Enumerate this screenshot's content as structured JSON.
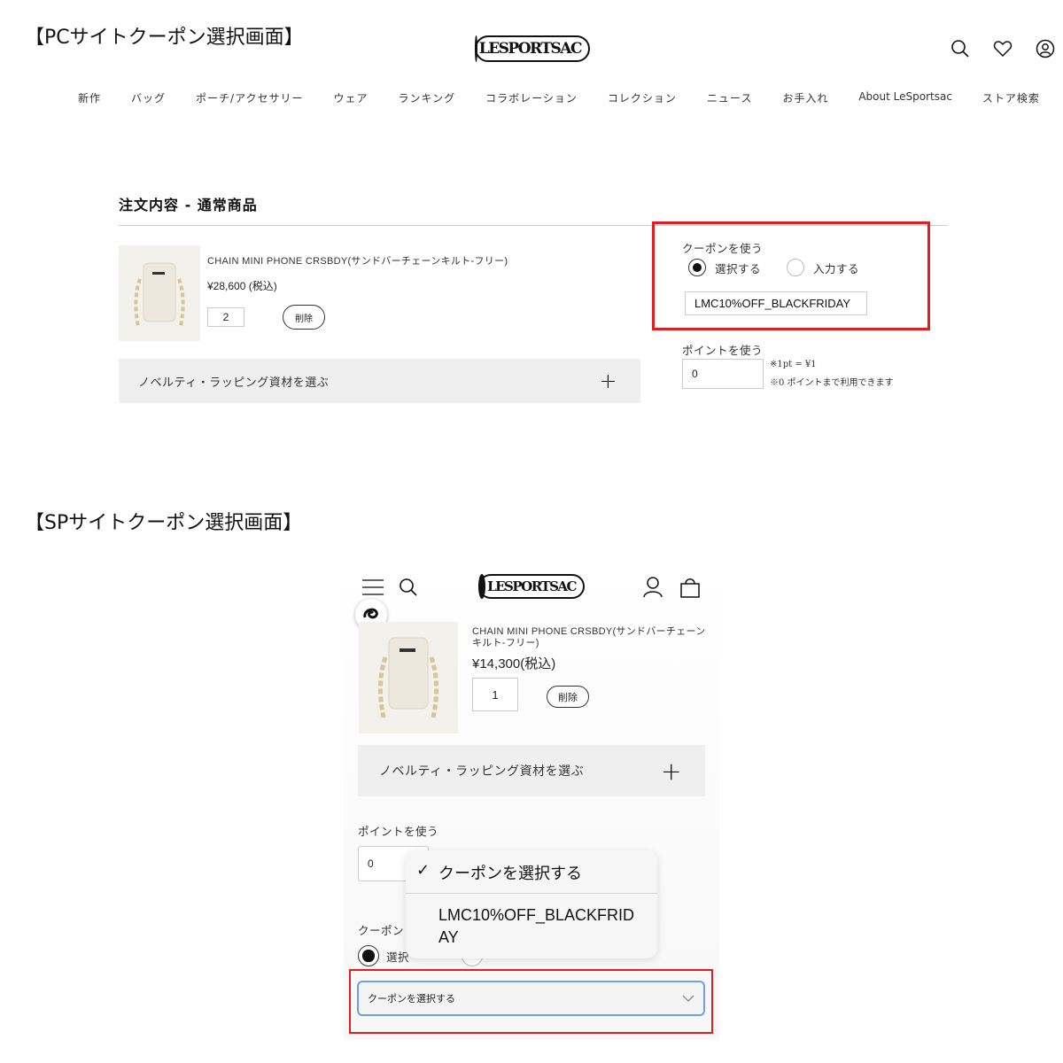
{
  "pc": {
    "section_title": "【PCサイトクーポン選択画面】",
    "logo_text": "LESPORTSAC",
    "nav": [
      "新作",
      "バッグ",
      "ポーチ/アクセサリー",
      "ウェア",
      "ランキング",
      "コラボレーション",
      "コレクション",
      "ニュース",
      "お手入れ",
      "About LeSportsac",
      "ストア検索"
    ],
    "icons": [
      "search-icon",
      "heart-icon",
      "account-icon"
    ],
    "order_title": "注文内容 - 通常商品",
    "product": {
      "name": "CHAIN MINI PHONE CRSBDY(サンドバーチェーンキルト-フリー)",
      "price": "¥28,600 (税込)",
      "quantity": "2",
      "delete_label": "削除"
    },
    "novelty_label": "ノベルティ・ラッピング資材を選ぶ",
    "novelty_toggle": "+",
    "coupon": {
      "label": "クーポンを使う",
      "option_select": "選択する",
      "option_input": "入力する",
      "selected_option": "選択する",
      "selected_value": "LMC10%OFF_BLACKFRIDAY"
    },
    "points": {
      "label": "ポイントを使う",
      "value": "0",
      "note1": "※1pt = ¥1",
      "note2": "※0 ポイントまで利用できます"
    },
    "highlight_color": "#e02020"
  },
  "sp": {
    "section_title": "【SPサイトクーポン選択画面】",
    "logo_text": "LESPORTSAC",
    "icons": [
      "menu-icon",
      "search-icon",
      "account-icon",
      "cart-icon"
    ],
    "product": {
      "name_line1": "CHAIN MINI PHONE CRSBDY(サンドバーチェーン",
      "name_line2": "キルト-フリー)",
      "price": "¥14,300(税込)",
      "quantity": "1",
      "delete_label": "削除"
    },
    "novelty_label": "ノベルティ・ラッピング資材を選ぶ",
    "novelty_toggle": "+",
    "points": {
      "label": "ポイントを使う",
      "value": "0"
    },
    "coupon": {
      "label": "クーポン",
      "option_select": "選択",
      "select_placeholder": "クーポンを選択する"
    },
    "dropdown": {
      "check_mark": "✓",
      "option1": "クーポンを選択する",
      "option2_line1": "LMC10%OFF_BLACKFRID",
      "option2_line2": "AY"
    },
    "select_border_color": "#6ba3e0",
    "highlight_color": "#e02020"
  }
}
